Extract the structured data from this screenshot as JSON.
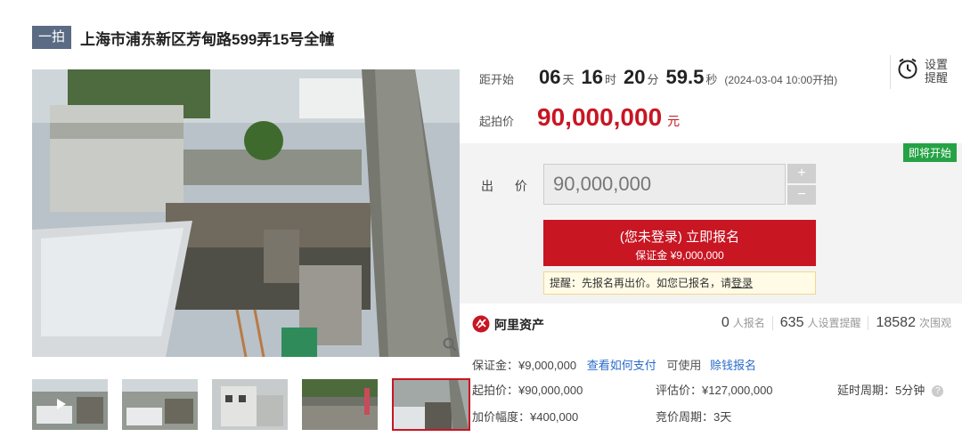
{
  "header": {
    "tag": "一拍",
    "title": "上海市浦东新区芳甸路599弄15号全幢"
  },
  "countdown": {
    "label": "距开始",
    "days": "06",
    "days_unit": "天",
    "hours": "16",
    "hours_unit": "时",
    "minutes": "20",
    "minutes_unit": "分",
    "seconds": "59.5",
    "seconds_unit": "秒",
    "start_note": "(2024-03-04 10:00开拍)"
  },
  "reminder": {
    "label_line1": "设置",
    "label_line2": "提醒",
    "icon": "alarm-clock-icon"
  },
  "start_price": {
    "label": "起拍价",
    "value": "90,000,000",
    "unit": "元"
  },
  "bid": {
    "status_badge": "即将开始",
    "label": "出 价",
    "value": "90,000,000",
    "plus": "+",
    "minus": "−",
    "signup_line1": "(您未登录) 立即报名",
    "signup_line2": "保证金 ¥9,000,000",
    "tip_text": "提醒：先报名再出价。如您已报名，请",
    "tip_link": "登录"
  },
  "platform": {
    "name": "阿里资产",
    "icon": "ali-asset-logo-icon"
  },
  "stats": [
    {
      "num": "0",
      "label": "人报名"
    },
    {
      "num": "635",
      "label": "人设置提醒"
    },
    {
      "num": "18582",
      "label": "次围观"
    }
  ],
  "deposit": {
    "text": "保证金：¥9,000,000",
    "pay_link": "查看如何支付",
    "usable": "可使用",
    "sesame_link": "赊钱报名"
  },
  "details": {
    "start_price": "起拍价：¥90,000,000",
    "appraisal": "评估价：¥127,000,000",
    "delay": "延时周期：5分钟",
    "increment": "加价幅度：¥400,000",
    "cycle": "竞价周期：3天"
  },
  "colors": {
    "accent": "#c81623",
    "badge_green": "#25a244",
    "link_blue": "#2a6bcc",
    "tag_bg": "#5a6b83"
  }
}
